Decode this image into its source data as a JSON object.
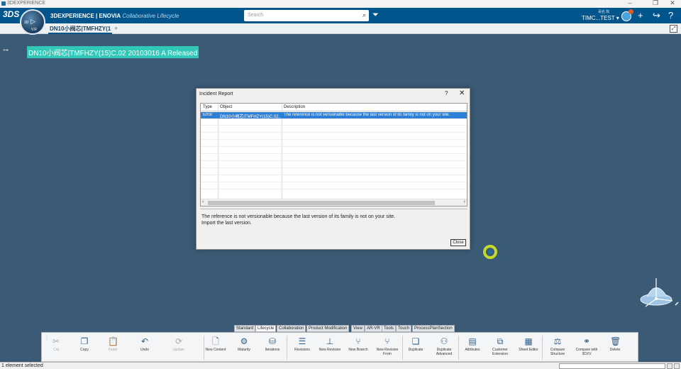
{
  "window": {
    "title": "3DEXPERIENCE",
    "controls": [
      "–",
      "❐",
      "✕"
    ]
  },
  "topbar": {
    "brand_bold": "3DEXPERIENCE | ENOVIA",
    "brand_sub": "Collaborative Lifecycle",
    "search_placeholder": "Search",
    "user_small": "哥名 陈",
    "user_name": "TIMC...TEST ▾",
    "compass_labels": [
      "3D",
      "V.R"
    ]
  },
  "tabs": [
    {
      "label": "DN10小阀芯|TMFHZY(1"
    }
  ],
  "canvas": {
    "tree_node_label": "DN10小阀芯|TMFHZY(15)C.02 20103016 A Released"
  },
  "dialog": {
    "title": "Incident Report",
    "help": "?",
    "close_x": "✕",
    "columns": [
      "Type",
      "Object",
      "Description"
    ],
    "rows": [
      {
        "type": "Error",
        "object": "DN10小阀芯|TMFHZY(15)C.02...",
        "description": "The reference is not versionable because the last version of its family is not on your site."
      }
    ],
    "message_line1": "The reference is not versionable because the last version of its family is not on your site.",
    "message_line2": "Import the last version.",
    "close_button": "Close"
  },
  "actionbar": {
    "tabs": [
      "Standard",
      "Lifecycle",
      "Collaboration",
      "Product Modification",
      "View",
      "AR-VR",
      "Tools",
      "Touch",
      "ProcessPlanSection"
    ],
    "active_tab": "Lifecycle",
    "commands": [
      {
        "label": "Cut",
        "icon": "scissors-icon",
        "glyph": "✂",
        "enabled": false
      },
      {
        "label": "Copy",
        "icon": "copy-icon",
        "glyph": "❐",
        "enabled": true
      },
      {
        "label": "Paste",
        "icon": "paste-icon",
        "glyph": "📋",
        "enabled": false
      },
      {
        "label": "Undo",
        "icon": "undo-icon",
        "glyph": "↶",
        "enabled": true
      },
      {
        "label": "Update",
        "icon": "update-icon",
        "glyph": "⟳",
        "enabled": false
      },
      {
        "label": "New Content",
        "icon": "new-content-icon",
        "glyph": "🗋",
        "enabled": true
      },
      {
        "label": "Maturity",
        "icon": "maturity-icon",
        "glyph": "⚙",
        "enabled": true
      },
      {
        "label": "Iterations",
        "icon": "iterations-icon",
        "glyph": "⛁",
        "enabled": true
      },
      {
        "label": "Revisions",
        "icon": "revisions-icon",
        "glyph": "☰",
        "enabled": true
      },
      {
        "label": "New Revision",
        "icon": "new-revision-icon",
        "glyph": "⊥",
        "enabled": true
      },
      {
        "label": "New Branch",
        "icon": "new-branch-icon",
        "glyph": "⑂",
        "enabled": true
      },
      {
        "label": "New Revision From",
        "icon": "new-revision-from-icon",
        "glyph": "⑂",
        "enabled": true
      },
      {
        "label": "Duplicate",
        "icon": "duplicate-icon",
        "glyph": "❏",
        "enabled": true
      },
      {
        "label": "Duplicate Advanced",
        "icon": "duplicate-advanced-icon",
        "glyph": "⚇",
        "enabled": true
      },
      {
        "label": "Attributes",
        "icon": "attributes-icon",
        "glyph": "▤",
        "enabled": true
      },
      {
        "label": "Customer Extension",
        "icon": "customer-extension-icon",
        "glyph": "⧉",
        "enabled": true
      },
      {
        "label": "Sheet Editor",
        "icon": "sheet-editor-icon",
        "glyph": "▦",
        "enabled": true
      },
      {
        "label": "Compare Structure",
        "icon": "compare-structure-icon",
        "glyph": "⚖",
        "enabled": true
      },
      {
        "label": "Compare with 3DXV",
        "icon": "compare-3dxv-icon",
        "glyph": "⚭",
        "enabled": true
      },
      {
        "label": "Delete",
        "icon": "trash-icon",
        "glyph": "🗑",
        "enabled": true
      }
    ]
  },
  "status": {
    "text": "1 element selected"
  },
  "colors": {
    "background": "#3a5a75",
    "topbar": "#00558c",
    "selection": "#2e7fd6",
    "highlight": "#32c8b8"
  }
}
